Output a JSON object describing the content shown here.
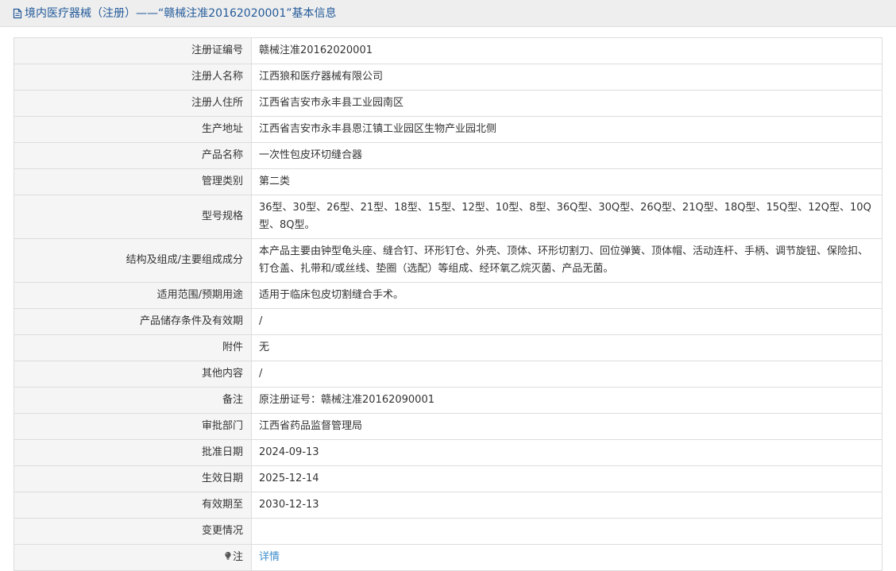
{
  "header": {
    "icon": "document-icon",
    "title": "境内医疗器械（注册）——“赣械注准20162020001”基本信息"
  },
  "rows": [
    {
      "label": "注册证编号",
      "value": "赣械注准20162020001"
    },
    {
      "label": "注册人名称",
      "value": "江西狼和医疗器械有限公司"
    },
    {
      "label": "注册人住所",
      "value": "江西省吉安市永丰县工业园南区"
    },
    {
      "label": "生产地址",
      "value": "江西省吉安市永丰县恩江镇工业园区生物产业园北侧"
    },
    {
      "label": "产品名称",
      "value": "一次性包皮环切缝合器"
    },
    {
      "label": "管理类别",
      "value": "第二类"
    },
    {
      "label": "型号规格",
      "value": "36型、30型、26型、21型、18型、15型、12型、10型、8型、36Q型、30Q型、26Q型、21Q型、18Q型、15Q型、12Q型、10Q型、8Q型。"
    },
    {
      "label": "结构及组成/主要组成成分",
      "value": "本产品主要由钟型龟头座、缝合钉、环形钉仓、外壳、顶体、环形切割刀、回位弹簧、顶体帽、活动连杆、手柄、调节旋钮、保险扣、钉仓盖、扎带和/或丝线、垫圈（选配）等组成、经环氧乙烷灭菌、产品无菌。"
    },
    {
      "label": "适用范围/预期用途",
      "value": "适用于临床包皮切割缝合手术。"
    },
    {
      "label": "产品储存条件及有效期",
      "value": "/"
    },
    {
      "label": "附件",
      "value": "无"
    },
    {
      "label": "其他内容",
      "value": "/"
    },
    {
      "label": "备注",
      "value": "原注册证号：赣械注准20162090001"
    },
    {
      "label": "审批部门",
      "value": "江西省药品监督管理局"
    },
    {
      "label": "批准日期",
      "value": "2024-09-13"
    },
    {
      "label": "生效日期",
      "value": "2025-12-14"
    },
    {
      "label": "有效期至",
      "value": "2030-12-13"
    },
    {
      "label": "变更情况",
      "value": ""
    }
  ],
  "note_row": {
    "icon": "lightbulb-icon",
    "label": "注",
    "link_text": "详情"
  },
  "colors": {
    "header_bg": "#eeeeee",
    "header_text": "#235a9a",
    "label_bg": "#f5f5f5",
    "border": "#dddddd",
    "link": "#3c8dcd"
  }
}
